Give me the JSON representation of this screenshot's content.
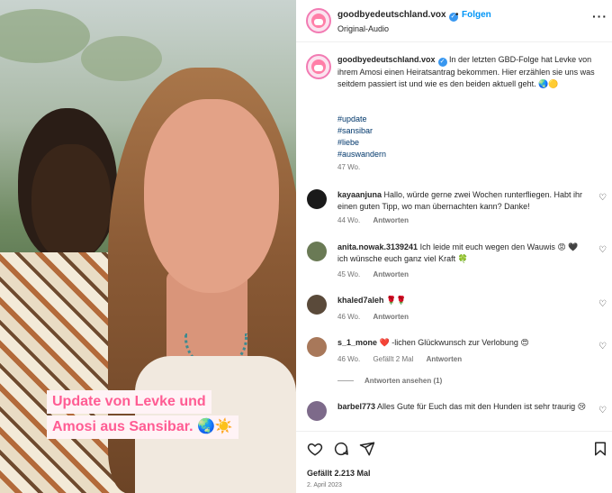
{
  "media": {
    "caption_line1": "Update von Levke und",
    "caption_line2": "Amosi aus Sansibar. 🌏☀️"
  },
  "header": {
    "username": "goodbyedeutschland.vox",
    "dot": "•",
    "follow_label": "Folgen",
    "audio_label": "Original-Audio",
    "more_label": "···"
  },
  "caption": {
    "username": "goodbyedeutschland.vox",
    "text": "In der letzten GBD-Folge hat Levke von ihrem Amosi einen Heiratsantrag bekommen. Hier erzählen sie uns was seitdem passiert ist und wie es den beiden aktuell geht. 🌏🟡",
    "hashtags": [
      "#update",
      "#sansibar",
      "#liebe",
      "#auswandern"
    ],
    "time": "47 Wo."
  },
  "comments": [
    {
      "username": "kayaanjuna",
      "text": "Hallo, würde gerne zwei Wochen runterfliegen. Habt ihr einen guten Tipp, wo man übernachten kann? Danke!",
      "time": "44 Wo.",
      "likes": "",
      "reply_label": "Antworten",
      "avatar_color": "#1a1a1a"
    },
    {
      "username": "anita.nowak.3139241",
      "text": "Ich leide mit euch wegen den Wauwis 😡 🖤 ich wünsche euch ganz viel Kraft 🍀",
      "time": "45 Wo.",
      "likes": "",
      "reply_label": "Antworten",
      "avatar_color": "#6a7a55"
    },
    {
      "username": "khaled7aleh",
      "text": "🌹🌹",
      "time": "46 Wo.",
      "likes": "",
      "reply_label": "Antworten",
      "avatar_color": "#5a4a3a"
    },
    {
      "username": "s_1_mone",
      "text": "❤️ -lichen Glückwunsch zur Verlobung 😍",
      "time": "46 Wo.",
      "likes": "Gefällt 2 Mal",
      "reply_label": "Antworten",
      "avatar_color": "#a8785a"
    },
    {
      "username": "barbel773",
      "text": "Alles Gute für Euch das mit den Hunden ist sehr traurig 😢",
      "time": "",
      "likes": "",
      "reply_label": "",
      "avatar_color": "#7d6a8a"
    }
  ],
  "view_replies_label": "Antworten ansehen (1)",
  "icons": {
    "like": "heart-icon",
    "comment": "comment-icon",
    "share": "share-icon",
    "save": "bookmark-icon"
  },
  "footer": {
    "likes_label": "Gefällt 2.213 Mal",
    "date": "2. April 2023"
  },
  "colors": {
    "accent": "#0095f6",
    "caption_pink": "#ff5c93",
    "verified": "#3897f0"
  }
}
